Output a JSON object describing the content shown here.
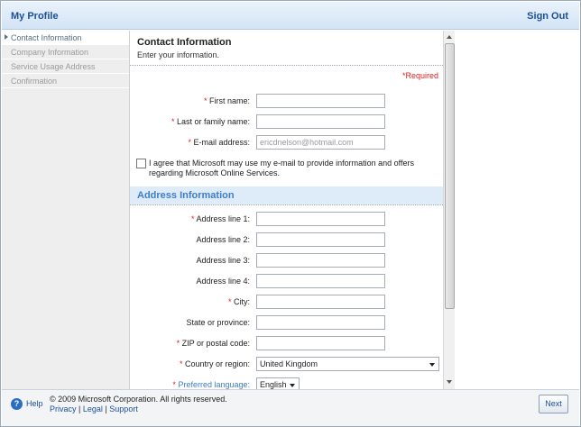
{
  "header": {
    "title": "My Profile",
    "signout_label": "Sign Out"
  },
  "sidebar": {
    "items": [
      {
        "label": "Contact Information",
        "active": true
      },
      {
        "label": "Company Information",
        "active": false
      },
      {
        "label": "Service Usage Address",
        "active": false
      },
      {
        "label": "Confirmation",
        "active": false
      }
    ]
  },
  "contact": {
    "title": "Contact Information",
    "subtitle": "Enter your information.",
    "required_note": "*Required",
    "fields": {
      "first_name": {
        "label": "First name:",
        "value": "",
        "placeholder": ""
      },
      "last_name": {
        "label": "Last or family name:",
        "value": "",
        "placeholder": ""
      },
      "email": {
        "label": "E-mail address:",
        "value": "",
        "placeholder": "ericdnelson@hotmail.com"
      }
    },
    "agree_text": "I agree that Microsoft may use my e-mail to provide information and offers regarding Microsoft Online Services."
  },
  "address": {
    "title": "Address Information",
    "fields": {
      "line1": {
        "label": "Address line 1:",
        "required": true
      },
      "line2": {
        "label": "Address line 2:",
        "required": false
      },
      "line3": {
        "label": "Address line 3:",
        "required": false
      },
      "line4": {
        "label": "Address line 4:",
        "required": false
      },
      "city": {
        "label": "City:",
        "required": true
      },
      "state": {
        "label": "State or province:",
        "required": false
      },
      "zip": {
        "label": "ZIP or postal code:",
        "required": true
      },
      "country": {
        "label": "Country or region:",
        "value": "United Kingdom",
        "required": true
      },
      "language": {
        "label": "Preferred language:",
        "value": "English",
        "required": true
      }
    }
  },
  "footer": {
    "help_label": "Help",
    "copyright": "© 2009 Microsoft Corporation. All rights reserved.",
    "privacy": "Privacy",
    "legal": "Legal",
    "support": "Support",
    "separator": "|",
    "next_label": "Next"
  },
  "colors": {
    "brand": "#1b4f9c",
    "required": "#e02020",
    "section_band": "#deebf8"
  },
  "icons": {
    "help": "help-icon",
    "active_marker": "triangle-right-icon"
  }
}
